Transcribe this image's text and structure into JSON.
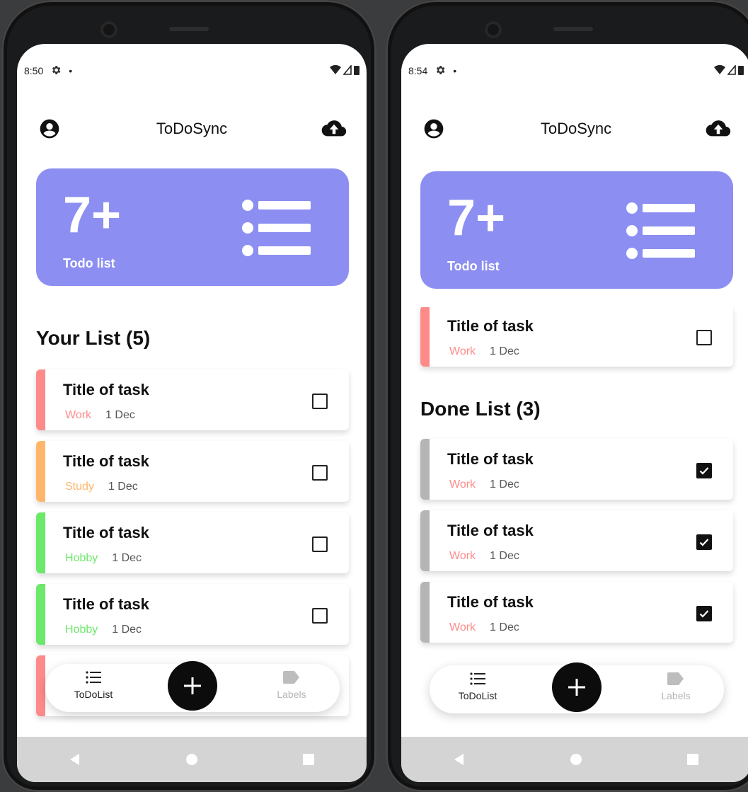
{
  "app": {
    "title": "ToDoSync"
  },
  "colors": {
    "work": "#ff8a8a",
    "study": "#ffb66b",
    "hobby": "#6ce86a",
    "done": "#b5b5b5",
    "banner": "#8c8ff1"
  },
  "left": {
    "status_time": "8:50",
    "banner": {
      "count": "7+",
      "label": "Todo list"
    },
    "list_title": "Your List (5)",
    "tasks": [
      {
        "title": "Title of task",
        "label": "Work",
        "date": "1 Dec",
        "color": "#ff8a8a"
      },
      {
        "title": "Title of task",
        "label": "Study",
        "date": "1 Dec",
        "color": "#ffb66b"
      },
      {
        "title": "Title of task",
        "label": "Hobby",
        "date": "1 Dec",
        "color": "#6ce86a"
      },
      {
        "title": "Title of task",
        "label": "Hobby",
        "date": "1 Dec",
        "color": "#6ce86a"
      },
      {
        "title": "",
        "label": "",
        "date": "",
        "color": "#ff8a8a"
      }
    ]
  },
  "right": {
    "status_time": "8:54",
    "banner": {
      "count": "7+",
      "label": "Todo list"
    },
    "partial_task": {
      "title": "Title of task",
      "label": "Work",
      "date": "1 Dec",
      "color": "#ff8a8a"
    },
    "done_title": "Done List (3)",
    "done_tasks": [
      {
        "title": "Title of task",
        "label": "Work",
        "date": "1 Dec"
      },
      {
        "title": "Title of task",
        "label": "Work",
        "date": "1 Dec"
      },
      {
        "title": "Title of task",
        "label": "Work",
        "date": "1 Dec"
      }
    ]
  },
  "nav": {
    "todolist_label": "ToDoList",
    "labels_label": "Labels"
  },
  "icons": {
    "profile": "account-circle-icon",
    "upload": "cloud-upload-icon",
    "list": "list-icon",
    "add": "plus-icon",
    "label": "label-tag-icon",
    "settings": "gear-icon"
  }
}
